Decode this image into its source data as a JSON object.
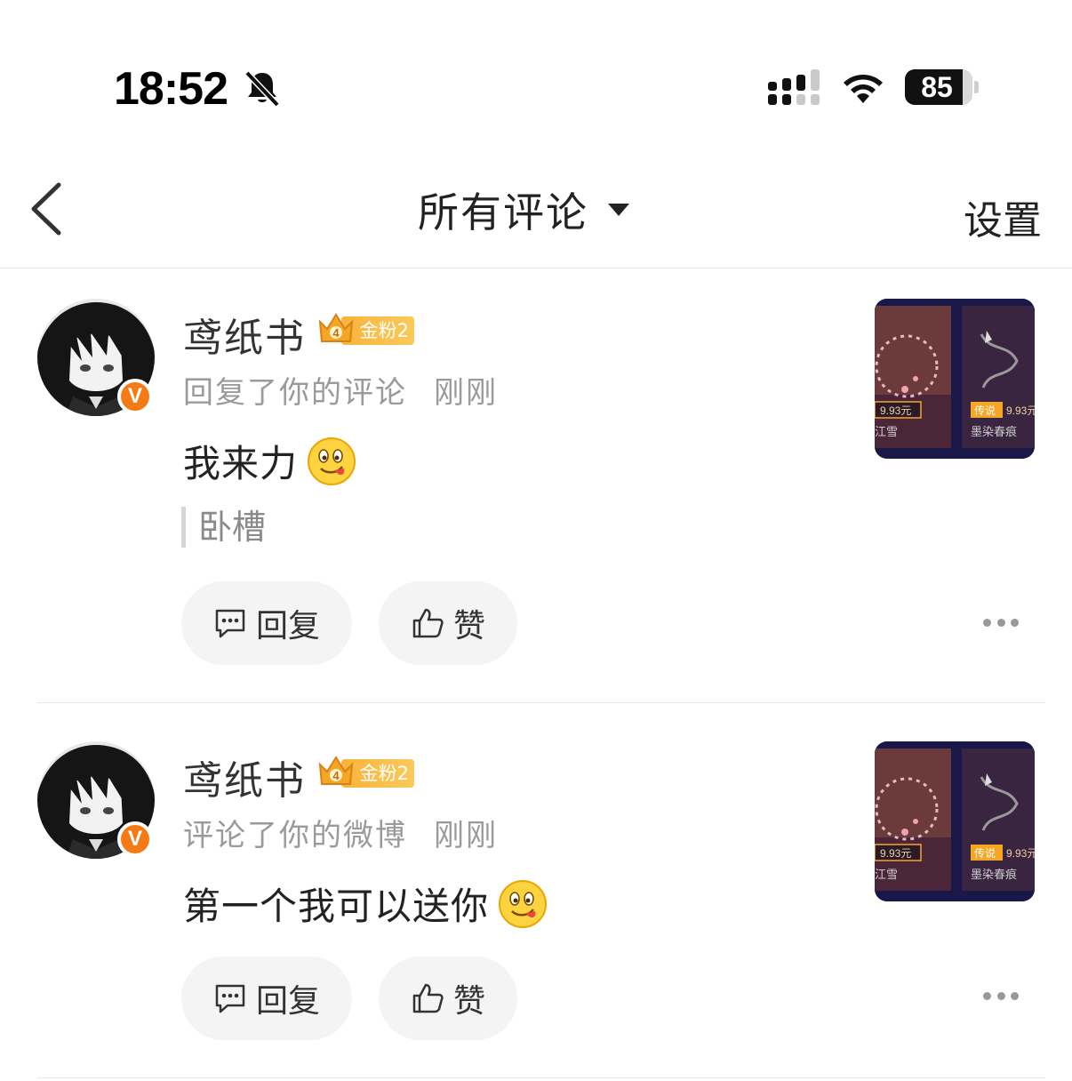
{
  "status_bar": {
    "time": "18:52",
    "battery": "85",
    "battery_level": 0.85
  },
  "nav": {
    "title": "所有评论",
    "settings_label": "设置"
  },
  "comments": [
    {
      "username": "鸢纸书",
      "fan_badge": "金粉2",
      "fan_level": "4",
      "action": "回复了你的评论",
      "time_ago": "刚刚",
      "text": "我来力",
      "emoji": "tongue-emoji",
      "quote": "卧槽",
      "reply_label": "回复",
      "like_label": "赞",
      "thumb": {
        "left_price": "9.93元",
        "left_name": "江雪",
        "right_tag": "传说",
        "right_price": "9.93元",
        "right_name": "墨染春痕"
      }
    },
    {
      "username": "鸢纸书",
      "fan_badge": "金粉2",
      "fan_level": "4",
      "action": "评论了你的微博",
      "time_ago": "刚刚",
      "text": "第一个我可以送你",
      "emoji": "tongue-emoji",
      "reply_label": "回复",
      "like_label": "赞",
      "thumb": {
        "left_price": "9.93元",
        "left_name": "江雪",
        "right_tag": "传说",
        "right_price": "9.93元",
        "right_name": "墨染春痕"
      }
    }
  ]
}
